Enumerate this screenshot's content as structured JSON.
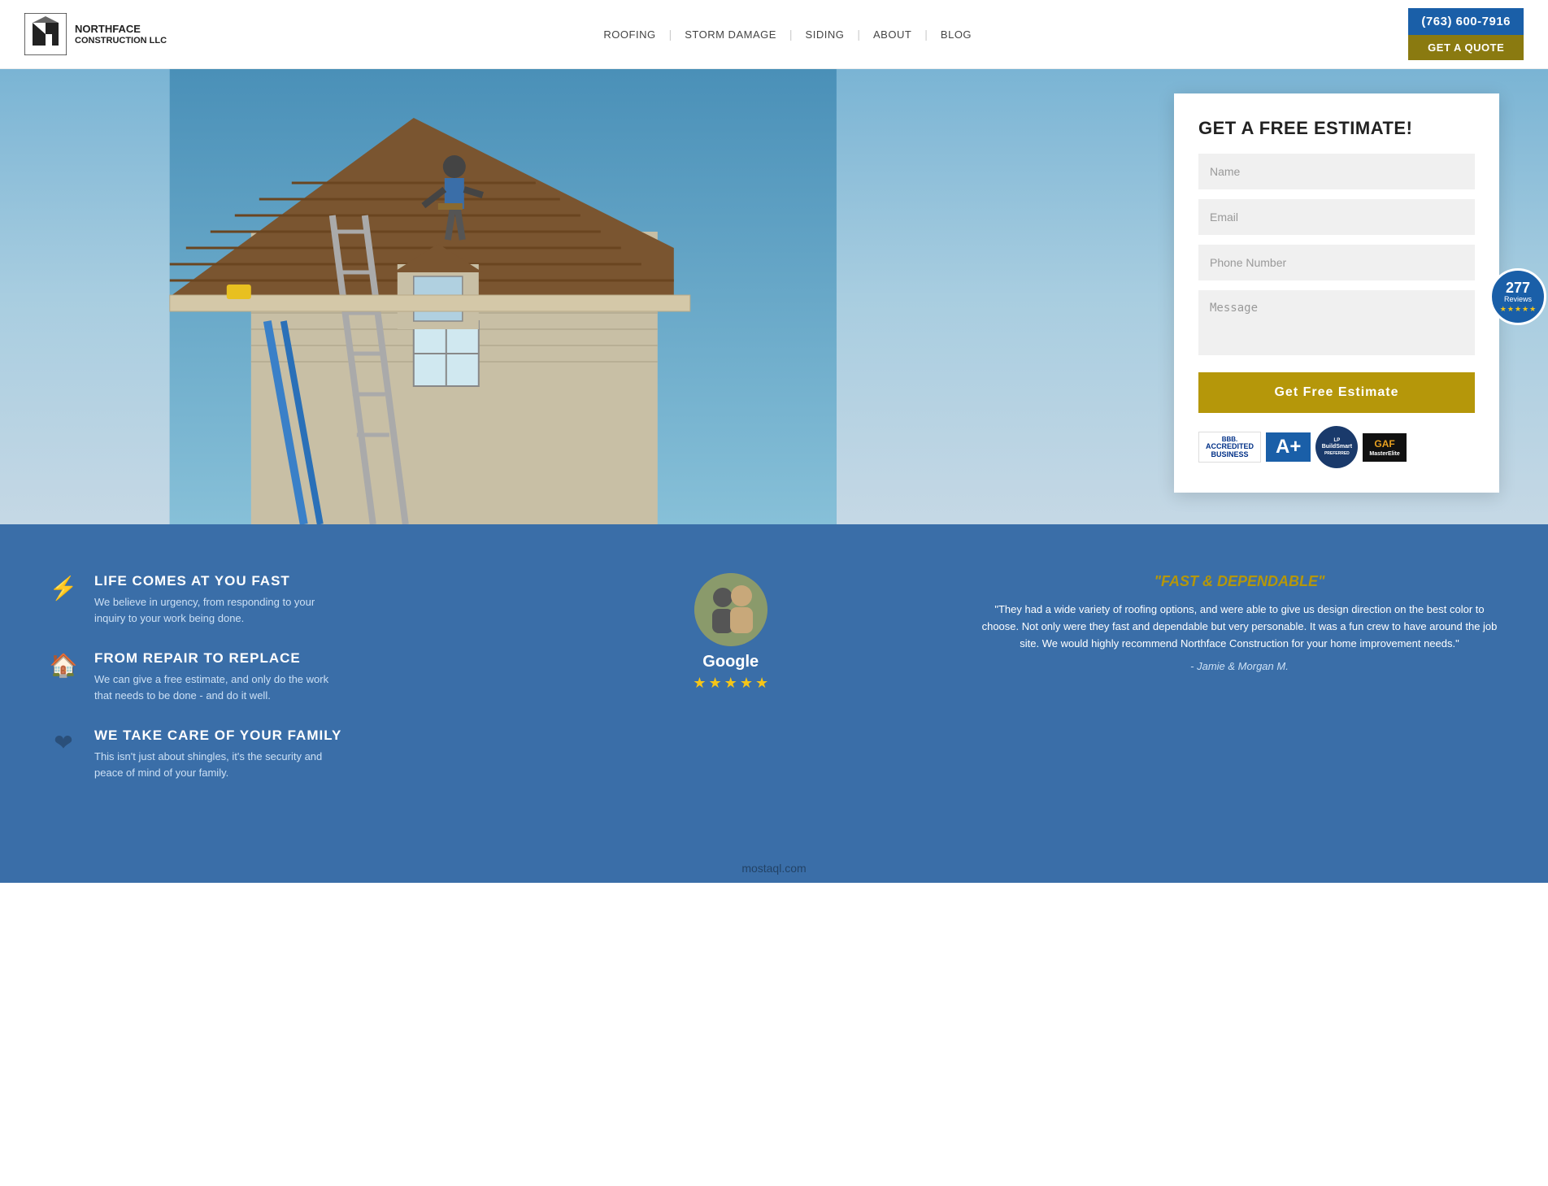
{
  "header": {
    "logo_line1": "NORTHFACE",
    "logo_line2": "CONSTRUCTION LLC",
    "phone": "(763) 600-7916",
    "quote_btn": "GET A QUOTE",
    "nav": [
      {
        "label": "ROOFING",
        "id": "roofing"
      },
      {
        "label": "STORM DAMAGE",
        "id": "storm-damage"
      },
      {
        "label": "SIDING",
        "id": "siding"
      },
      {
        "label": "ABOUT",
        "id": "about"
      },
      {
        "label": "BLOG",
        "id": "blog"
      }
    ]
  },
  "reviews_badge": {
    "count": "277",
    "label": "Reviews"
  },
  "form": {
    "title": "GET A FREE ESTIMATE!",
    "name_placeholder": "Name",
    "email_placeholder": "Email",
    "phone_placeholder": "Phone Number",
    "message_placeholder": "Message",
    "submit_label": "Get Free Estimate"
  },
  "badges": [
    {
      "type": "bbb",
      "line1": "BBB.",
      "line2": "ACCREDITED",
      "line3": "BUSINESS"
    },
    {
      "type": "aplus",
      "label": "A+"
    },
    {
      "type": "buildsmart",
      "label": "BuildSmart"
    },
    {
      "type": "gaf",
      "label": "GAF MasterElite"
    }
  ],
  "features": [
    {
      "icon": "⚡",
      "title": "LIFE COMES AT YOU FAST",
      "desc": "We believe in urgency, from responding to your inquiry to your work being done."
    },
    {
      "icon": "🏠",
      "title": "FROM REPAIR TO REPLACE",
      "desc": "We can give a free estimate, and only do the work that needs to be done - and do it well."
    },
    {
      "icon": "❤",
      "title": "WE TAKE CARE OF YOUR FAMILY",
      "desc": "This isn't just about shingles, it's the security and peace of mind of your family."
    }
  ],
  "google_review": {
    "label": "Google",
    "stars": 5
  },
  "testimonial": {
    "title": "\"FAST & DEPENDABLE\"",
    "text": "\"They had a wide variety of roofing options, and were able to give us design direction on the best color to choose. Not only were they fast and dependable but very personable. It was a fun crew to have around the job site. We would highly recommend Northface Construction for your home improvement needs.\"",
    "author": "- Jamie & Morgan M."
  },
  "watermark": {
    "text": "mostaql.com"
  }
}
